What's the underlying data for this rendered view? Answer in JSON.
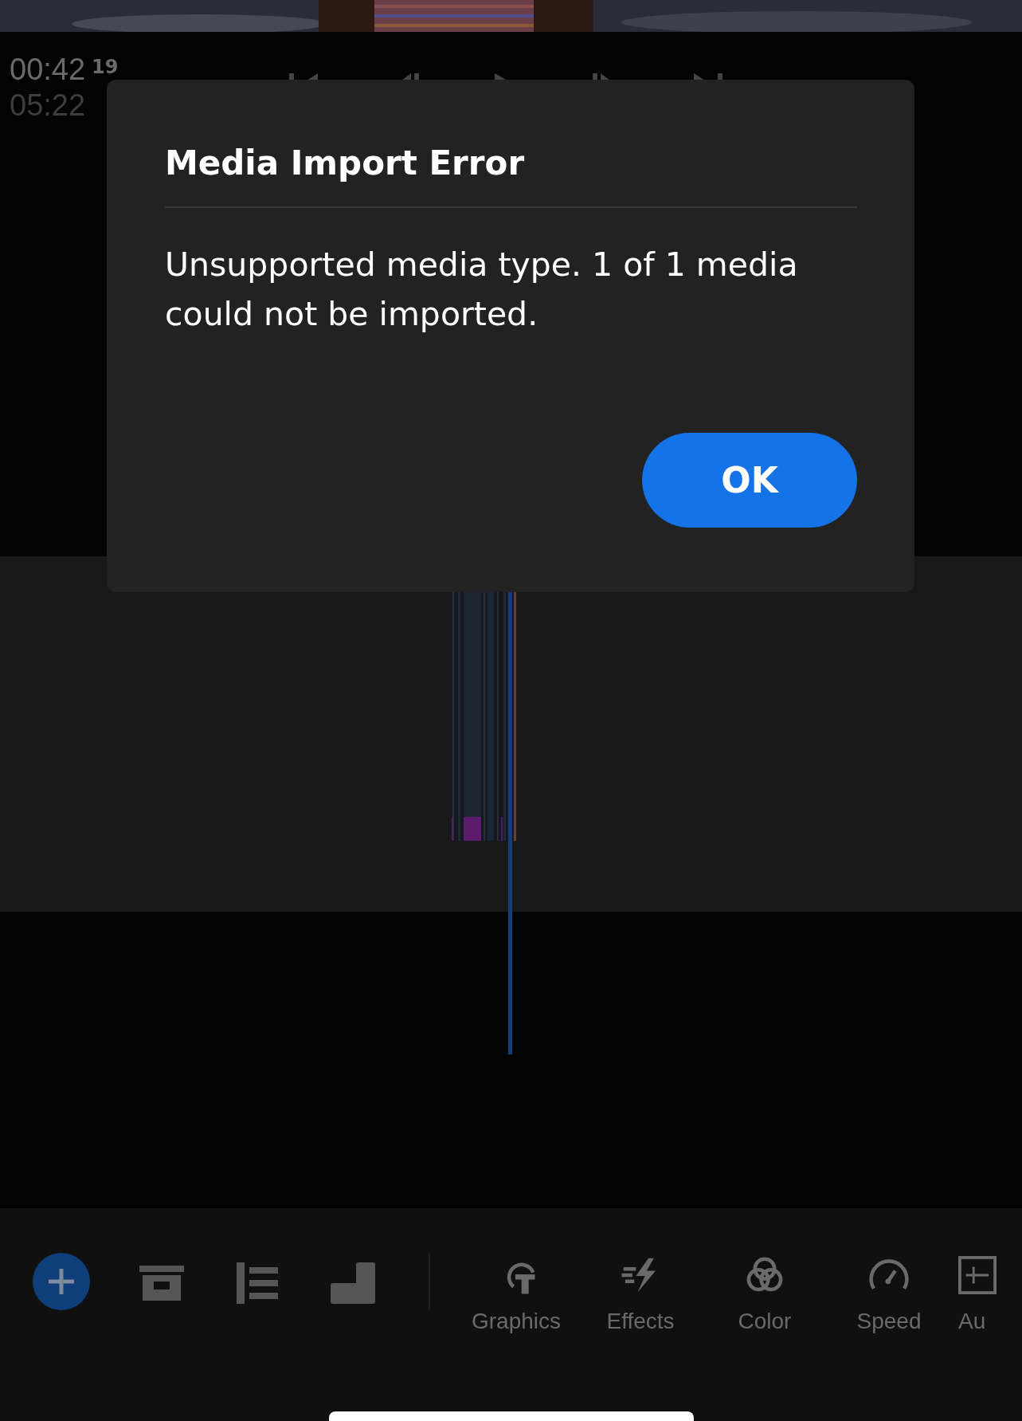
{
  "timecode": {
    "current": "00:42",
    "current_frames": "19",
    "duration": "05:22"
  },
  "dialog": {
    "title": "Media Import Error",
    "message": "Unsupported media type. 1 of 1 media could not be imported.",
    "button": "OK"
  },
  "tools": [
    {
      "label": "Graphics"
    },
    {
      "label": "Effects"
    },
    {
      "label": "Color"
    },
    {
      "label": "Speed"
    },
    {
      "label": "Au"
    }
  ]
}
